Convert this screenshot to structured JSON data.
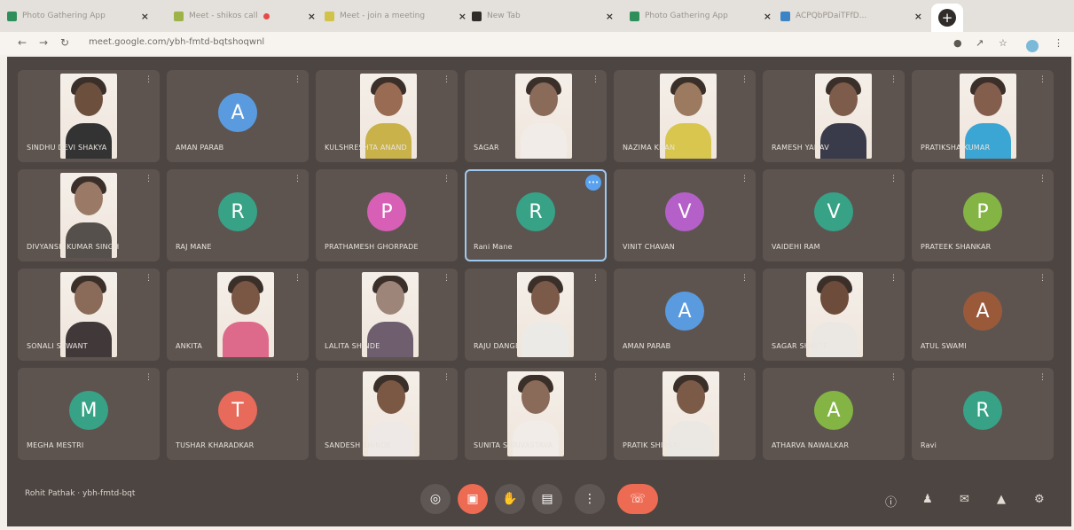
{
  "browser": {
    "tabs": [
      {
        "title": "Photo Gathering App",
        "fav_color": "#2f8f5b"
      },
      {
        "title": "Meet - shikos call",
        "fav_color": "#9db34a",
        "recording": true
      },
      {
        "title": "Meet - join a meeting",
        "fav_color": "#d1c34a"
      },
      {
        "title": "New Tab",
        "fav_color": "#2f2c29"
      },
      {
        "title": "Photo Gathering App",
        "fav_color": "#2f8f5b"
      },
      {
        "title": "ACPQbPDaiTFfD...",
        "fav_color": "#3c84c6"
      }
    ],
    "url": "meet.google.com/ybh-fmtd-bqtshoqwnl",
    "back_icon": "back-arrow-icon",
    "reload_icon": "reload-icon"
  },
  "tiles": [
    {
      "name": "SINDHU DEVI SHAKYA",
      "type": "photo",
      "skin": "#6d4f3e",
      "cloth": "#333333"
    },
    {
      "name": "AMAN PARAB",
      "type": "avatar",
      "letter": "A",
      "color": "#5a9be0"
    },
    {
      "name": "KULSHRESHTA ANAND",
      "type": "photo",
      "skin": "#9a6b53",
      "cloth": "#c9b24a"
    },
    {
      "name": "SAGAR",
      "type": "photo",
      "skin": "#8a6a58",
      "cloth": "#f1ece8"
    },
    {
      "name": "NAZIMA KHAN",
      "type": "photo",
      "skin": "#9b7a5f",
      "cloth": "#d8c64f"
    },
    {
      "name": "RAMESH YADAV",
      "type": "photo",
      "skin": "#7e5c4b",
      "cloth": "#3a3b4a"
    },
    {
      "name": "PRATIKSHA KUMAR",
      "type": "photo",
      "skin": "#845e4d",
      "cloth": "#3ba6d3"
    },
    {
      "name": "DIVYANSH KUMAR SINGH",
      "type": "photo",
      "skin": "#9a7a66",
      "cloth": "#56504c"
    },
    {
      "name": "RAJ MANE",
      "type": "avatar",
      "letter": "R",
      "color": "#37a286"
    },
    {
      "name": "PRATHAMESH GHORPADE",
      "type": "avatar",
      "letter": "P",
      "color": "#d75fb6"
    },
    {
      "name": "Rani Mane",
      "type": "avatar",
      "letter": "R",
      "color": "#37a286",
      "active": true
    },
    {
      "name": "VINIT CHAVAN",
      "type": "avatar",
      "letter": "V",
      "color": "#b560c8"
    },
    {
      "name": "VAIDEHI RAM",
      "type": "avatar",
      "letter": "V",
      "color": "#37a286"
    },
    {
      "name": "PRATEEK SHANKAR",
      "type": "avatar",
      "letter": "P",
      "color": "#84b544"
    },
    {
      "name": "SONALI SAWANT",
      "type": "photo",
      "skin": "#8a6a58",
      "cloth": "#41383a"
    },
    {
      "name": "ANKITA",
      "type": "photo",
      "skin": "#7a5644",
      "cloth": "#dd6a8a"
    },
    {
      "name": "LALITA SHINDE",
      "type": "photo",
      "skin": "#9e8579",
      "cloth": "#6e5e6e"
    },
    {
      "name": "RAJU DANGE",
      "type": "photo",
      "skin": "#7c5a49",
      "cloth": "#eceae6"
    },
    {
      "name": "AMAN PARAB",
      "type": "avatar",
      "letter": "A",
      "color": "#5a9be0"
    },
    {
      "name": "SAGAR SHINDE",
      "type": "photo",
      "skin": "#6e4c3b",
      "cloth": "#ebe8e4"
    },
    {
      "name": "ATUL SWAMI",
      "type": "avatar",
      "letter": "A",
      "color": "#9a5a3a"
    },
    {
      "name": "MEGHA MESTRI",
      "type": "avatar",
      "letter": "M",
      "color": "#37a286"
    },
    {
      "name": "TUSHAR KHARADKAR",
      "type": "avatar",
      "letter": "T",
      "color": "#e76a5a"
    },
    {
      "name": "SANDESH SHINDE",
      "type": "photo",
      "skin": "#7a5844",
      "cloth": "#eee9e6"
    },
    {
      "name": "SUNITA SHRIVASTAVA",
      "type": "photo",
      "skin": "#8a6a58",
      "cloth": "#f1ece8"
    },
    {
      "name": "PRATIK SHIRSAT",
      "type": "photo",
      "skin": "#7b5a47",
      "cloth": "#ebe8e4"
    },
    {
      "name": "ATHARVA NAWALKAR",
      "type": "avatar",
      "letter": "A",
      "color": "#84b544"
    },
    {
      "name": "Ravi",
      "type": "avatar",
      "letter": "R",
      "color": "#37a286"
    }
  ],
  "bottom": {
    "meeting_info": "Rohit Pathak · ybh-fmtd-bqt",
    "buttons": [
      {
        "name": "mic-button",
        "icon": "mic-icon"
      },
      {
        "name": "camera-button",
        "icon": "camera-icon"
      },
      {
        "name": "raise-hand-button",
        "icon": "hand-icon"
      },
      {
        "name": "present-button",
        "icon": "present-icon"
      },
      {
        "name": "more-options-button",
        "icon": "more-vert-icon"
      },
      {
        "name": "leave-call-button",
        "icon": "phone-hangup-icon"
      }
    ],
    "right_icons": [
      "info-icon",
      "people-icon",
      "chat-icon",
      "activities-icon",
      "host-controls-icon"
    ]
  }
}
